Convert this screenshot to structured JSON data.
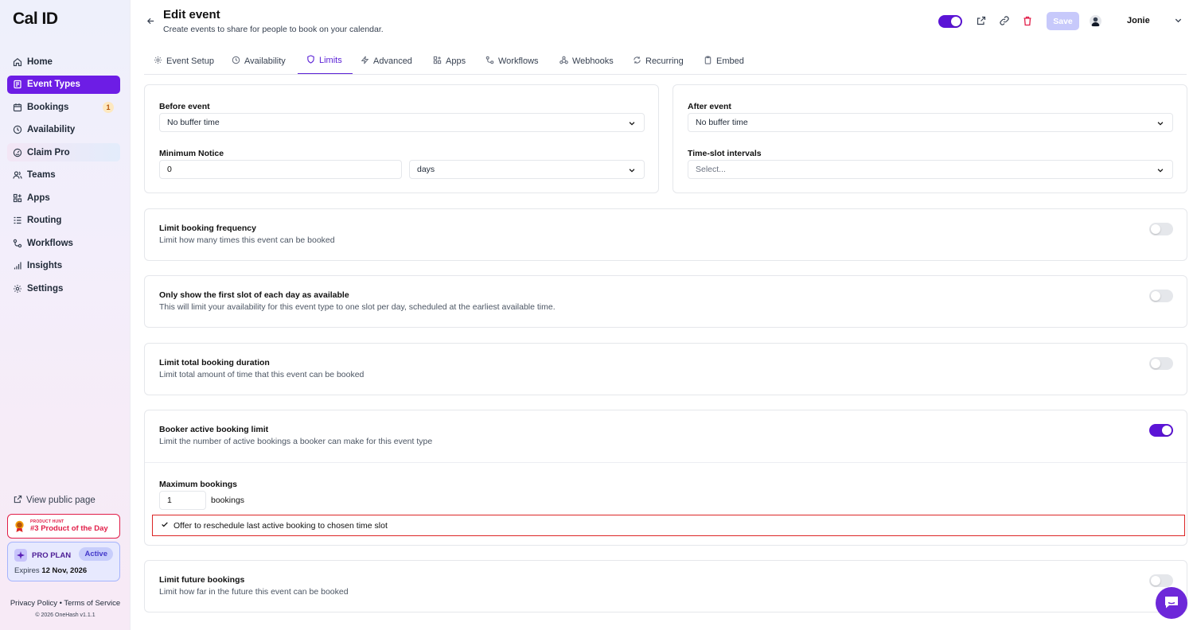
{
  "app": {
    "logo": "Cal ID"
  },
  "sidebar": {
    "items": [
      {
        "label": "Home",
        "icon": "home-icon"
      },
      {
        "label": "Event Types",
        "icon": "event-types-icon",
        "active": true
      },
      {
        "label": "Bookings",
        "icon": "calendar-icon",
        "badge": "1"
      },
      {
        "label": "Availability",
        "icon": "clock-icon"
      },
      {
        "label": "Claim Pro",
        "icon": "gauge-icon"
      },
      {
        "label": "Teams",
        "icon": "users-icon"
      },
      {
        "label": "Apps",
        "icon": "grid-plus-icon"
      },
      {
        "label": "Routing",
        "icon": "routing-icon"
      },
      {
        "label": "Workflows",
        "icon": "workflow-icon"
      },
      {
        "label": "Insights",
        "icon": "bar-chart-icon"
      },
      {
        "label": "Settings",
        "icon": "gear-icon"
      }
    ],
    "view_public_page": "View public page",
    "product_hunt": {
      "small": "PRODUCT HUNT",
      "big": "#3 Product of the Day"
    },
    "pro_plan": {
      "title": "PRO PLAN",
      "status": "Active",
      "expires_label": "Expires",
      "expires_date": "12 Nov, 2026"
    },
    "footer": {
      "links": "Privacy Policy • Terms of Service",
      "copyright": "© 2026 OneHash v1.1.1"
    }
  },
  "header": {
    "title": "Edit event",
    "subtitle": "Create events to share for people to book on your calendar.",
    "save_label": "Save",
    "user_name": "Jonie"
  },
  "tabs": [
    {
      "label": "Event Setup",
      "icon": "gear-icon"
    },
    {
      "label": "Availability",
      "icon": "clock-icon"
    },
    {
      "label": "Limits",
      "icon": "shield-icon",
      "active": true
    },
    {
      "label": "Advanced",
      "icon": "lightning-icon"
    },
    {
      "label": "Apps",
      "icon": "grid-plus-icon"
    },
    {
      "label": "Workflows",
      "icon": "workflow-icon"
    },
    {
      "label": "Webhooks",
      "icon": "webhook-icon"
    },
    {
      "label": "Recurring",
      "icon": "repeat-icon"
    },
    {
      "label": "Embed",
      "icon": "clipboard-icon"
    }
  ],
  "buffers": {
    "before_label": "Before event",
    "before_value": "No buffer time",
    "after_label": "After event",
    "after_value": "No buffer time",
    "min_notice_label": "Minimum Notice",
    "min_notice_value": "0",
    "min_notice_unit": "days",
    "interval_label": "Time-slot intervals",
    "interval_placeholder": "Select..."
  },
  "sections": {
    "frequency": {
      "title": "Limit booking frequency",
      "desc": "Limit how many times this event can be booked",
      "enabled": false
    },
    "first_slot": {
      "title": "Only show the first slot of each day as available",
      "desc": "This will limit your availability for this event type to one slot per day, scheduled at the earliest available time.",
      "enabled": false
    },
    "duration": {
      "title": "Limit total booking duration",
      "desc": "Limit total amount of time that this event can be booked",
      "enabled": false
    },
    "active_limit": {
      "title": "Booker active booking limit",
      "desc": "Limit the number of active bookings a booker can make for this event type",
      "enabled": true,
      "max_label": "Maximum bookings",
      "max_value": "1",
      "max_unit": "bookings",
      "reschedule_label": "Offer to reschedule last active booking to chosen time slot",
      "reschedule_checked": true
    },
    "future": {
      "title": "Limit future bookings",
      "desc": "Limit how far in the future this event can be booked",
      "enabled": false
    }
  },
  "colors": {
    "brand": "#5b14d6",
    "active_nav": "#6d1de5",
    "highlight_border": "#dc2626"
  }
}
